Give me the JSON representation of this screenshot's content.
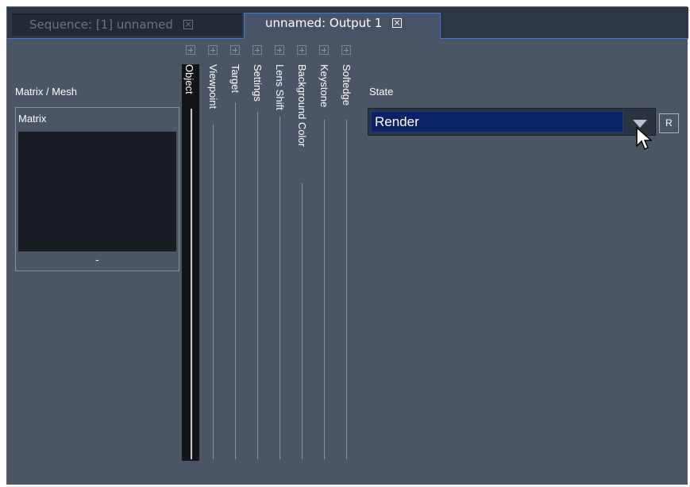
{
  "tabs": [
    {
      "label": "Sequence: [1] unnamed",
      "active": false
    },
    {
      "label": "unnamed: Output 1",
      "active": true
    }
  ],
  "matrix_mesh": {
    "title": "Matrix / Mesh",
    "list_header": "Matrix",
    "footer": "-"
  },
  "columns": [
    {
      "label": "Object",
      "selected": true
    },
    {
      "label": "Viewpoint",
      "selected": false
    },
    {
      "label": "Target",
      "selected": false
    },
    {
      "label": "Settings",
      "selected": false
    },
    {
      "label": "Lens Shift",
      "selected": false
    },
    {
      "label": "Background Color",
      "selected": false
    },
    {
      "label": "Keystone",
      "selected": false
    },
    {
      "label": "Softedge",
      "selected": false
    }
  ],
  "state": {
    "label": "State",
    "value": "Render",
    "reset_label": "R"
  },
  "colors": {
    "panel_bg": "#4a5566",
    "tab_accent": "#3d7bd8",
    "select_bg": "#0c2166"
  }
}
